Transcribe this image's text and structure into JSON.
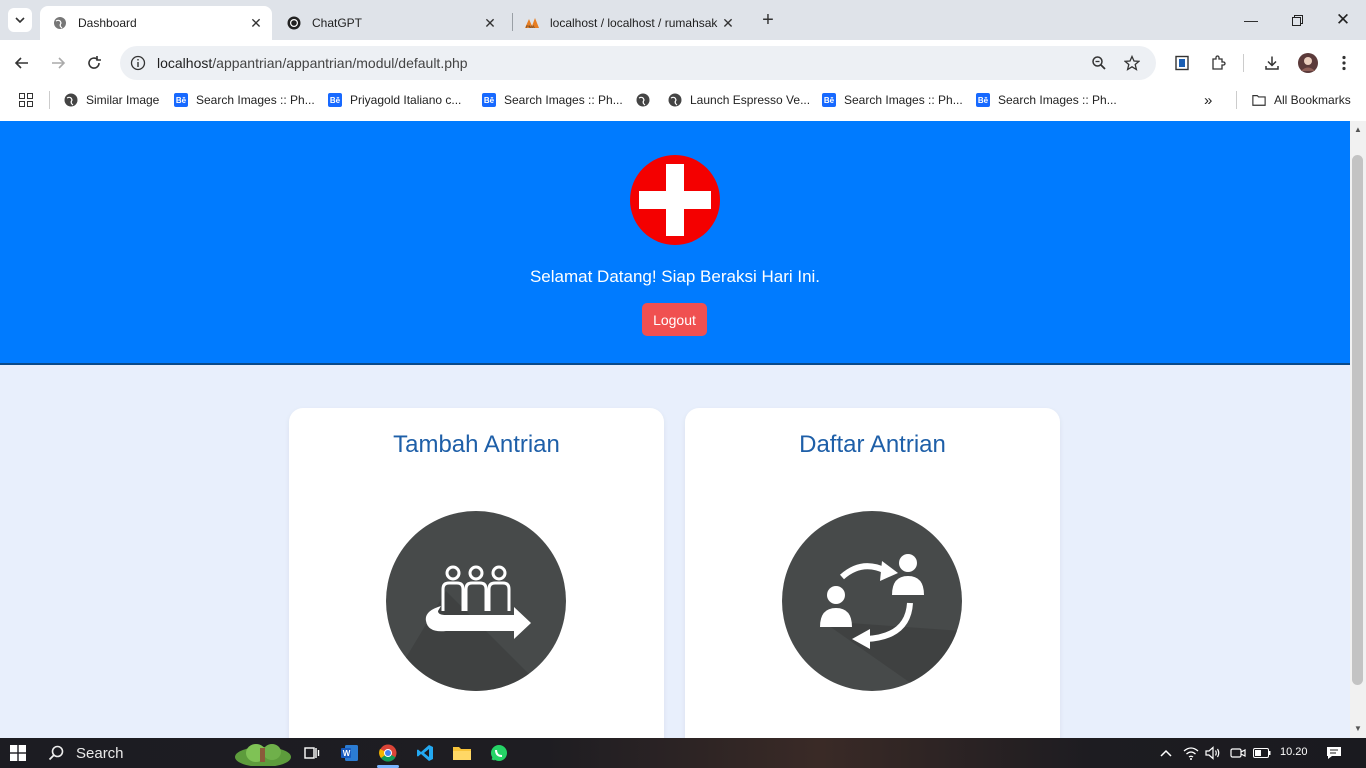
{
  "browser": {
    "tabs": [
      {
        "title": "Dashboard",
        "active": true
      },
      {
        "title": "ChatGPT",
        "active": false
      },
      {
        "title": "localhost / localhost / rumahsak",
        "active": false
      }
    ],
    "address": {
      "host": "localhost",
      "path": "/appantrian/appantrian/modul/default.php"
    },
    "bookmarks": [
      {
        "label": "Similar Image",
        "icon": "globe-icon"
      },
      {
        "label": "Search Images :: Ph...",
        "icon": "behance-icon"
      },
      {
        "label": "Priyagold Italiano c...",
        "icon": "behance-icon"
      },
      {
        "label": "Search Images :: Ph...",
        "icon": "behance-icon"
      },
      {
        "label": "",
        "icon": "globe-icon"
      },
      {
        "label": "Launch Espresso Ve...",
        "icon": "globe-icon"
      },
      {
        "label": "Search Images :: Ph...",
        "icon": "behance-icon"
      },
      {
        "label": "Search Images :: Ph...",
        "icon": "behance-icon"
      }
    ],
    "all_bookmarks": "All Bookmarks"
  },
  "page": {
    "welcome": "Selamat Datang! Siap Beraksi Hari Ini.",
    "logout_label": "Logout",
    "cards": [
      {
        "title": "Tambah Antrian",
        "icon": "queue-people-arrow-icon"
      },
      {
        "title": "Daftar Antrian",
        "icon": "people-exchange-icon"
      }
    ],
    "colors": {
      "header_bg": "#007bff",
      "logout_bg": "#f05050",
      "card_title": "#1e5fa8",
      "logo_red": "#f40000"
    }
  },
  "taskbar": {
    "search_label": "Search",
    "time": "10.20"
  }
}
